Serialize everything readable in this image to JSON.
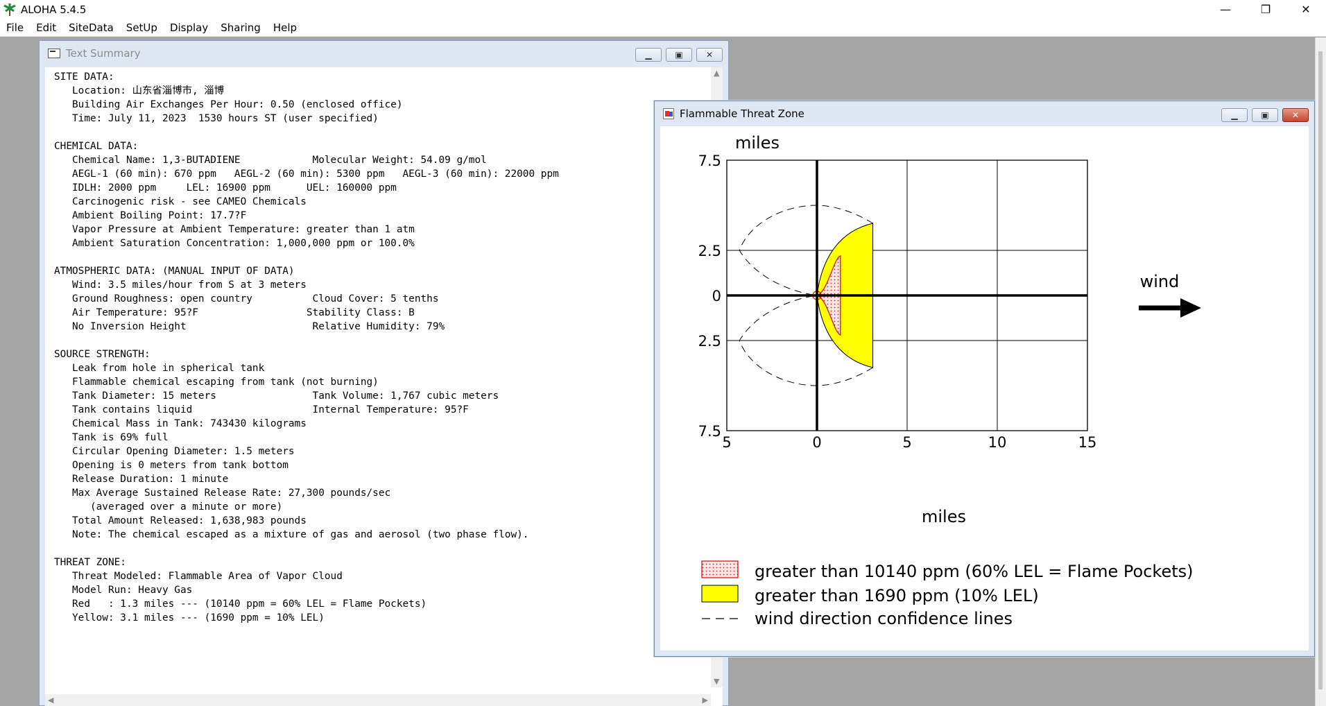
{
  "app": {
    "title": "ALOHA 5.4.5",
    "controls": {
      "minimize": "—",
      "restore": "❐",
      "close": "✕"
    }
  },
  "menu": {
    "items": [
      "File",
      "Edit",
      "SiteData",
      "SetUp",
      "Display",
      "Sharing",
      "Help"
    ]
  },
  "text_summary": {
    "title": "Text Summary",
    "lines": [
      "SITE DATA:",
      "   Location: 山东省淄博市, 淄博",
      "   Building Air Exchanges Per Hour: 0.50 (enclosed office)",
      "   Time: July 11, 2023  1530 hours ST (user specified)",
      "",
      "CHEMICAL DATA:",
      "   Chemical Name: 1,3-BUTADIENE            Molecular Weight: 54.09 g/mol",
      "   AEGL-1 (60 min): 670 ppm   AEGL-2 (60 min): 5300 ppm   AEGL-3 (60 min): 22000 ppm",
      "   IDLH: 2000 ppm     LEL: 16900 ppm      UEL: 160000 ppm",
      "   Carcinogenic risk - see CAMEO Chemicals",
      "   Ambient Boiling Point: 17.7?F",
      "   Vapor Pressure at Ambient Temperature: greater than 1 atm",
      "   Ambient Saturation Concentration: 1,000,000 ppm or 100.0%",
      "",
      "ATMOSPHERIC DATA: (MANUAL INPUT OF DATA)",
      "   Wind: 3.5 miles/hour from S at 3 meters",
      "   Ground Roughness: open country          Cloud Cover: 5 tenths",
      "   Air Temperature: 95?F                  Stability Class: B",
      "   No Inversion Height                     Relative Humidity: 79%",
      "",
      "SOURCE STRENGTH:",
      "   Leak from hole in spherical tank",
      "   Flammable chemical escaping from tank (not burning)",
      "   Tank Diameter: 15 meters                Tank Volume: 1,767 cubic meters",
      "   Tank contains liquid                    Internal Temperature: 95?F",
      "   Chemical Mass in Tank: 743430 kilograms",
      "   Tank is 69% full",
      "   Circular Opening Diameter: 1.5 meters",
      "   Opening is 0 meters from tank bottom",
      "   Release Duration: 1 minute",
      "   Max Average Sustained Release Rate: 27,300 pounds/sec",
      "      (averaged over a minute or more)",
      "   Total Amount Released: 1,638,983 pounds",
      "   Note: The chemical escaped as a mixture of gas and aerosol (two phase flow).",
      "",
      "THREAT ZONE:",
      "   Threat Modeled: Flammable Area of Vapor Cloud",
      "   Model Run: Heavy Gas",
      "   Red   : 1.3 miles --- (10140 ppm = 60% LEL = Flame Pockets)",
      "   Yellow: 3.1 miles --- (1690 ppm = 10% LEL)"
    ]
  },
  "threat_zone_window": {
    "title": "Flammable Threat Zone",
    "wind_label": "wind",
    "colors": {
      "red_zone": "#e00000",
      "yellow_zone": "#ffff00",
      "red_fill": "#f7d7d7"
    },
    "chart_data": {
      "type": "area",
      "xlabel": "miles",
      "ylabel": "miles",
      "xlim": [
        -5,
        15
      ],
      "ylim": [
        -7.5,
        7.5
      ],
      "x_tick_values": [
        -5,
        0,
        5,
        10,
        15
      ],
      "x_tick_labels": [
        "5",
        "0",
        "5",
        "10",
        "15"
      ],
      "y_tick_values": [
        7.5,
        2.5,
        0,
        -2.5,
        -7.5
      ],
      "y_tick_labels": [
        "7.5",
        "2.5",
        "0",
        "2.5",
        "7.5"
      ],
      "grid": true,
      "zones": [
        {
          "name": "red",
          "max_downwind_miles": 1.3
        },
        {
          "name": "yellow",
          "max_downwind_miles": 3.1
        }
      ],
      "legend": [
        {
          "swatch": "red-dotted",
          "label": "greater than 10140 ppm (60% LEL = Flame Pockets)"
        },
        {
          "swatch": "yellow",
          "label": "greater than 1690 ppm (10% LEL)"
        },
        {
          "swatch": "dashed",
          "label": "wind direction confidence lines"
        }
      ]
    }
  }
}
